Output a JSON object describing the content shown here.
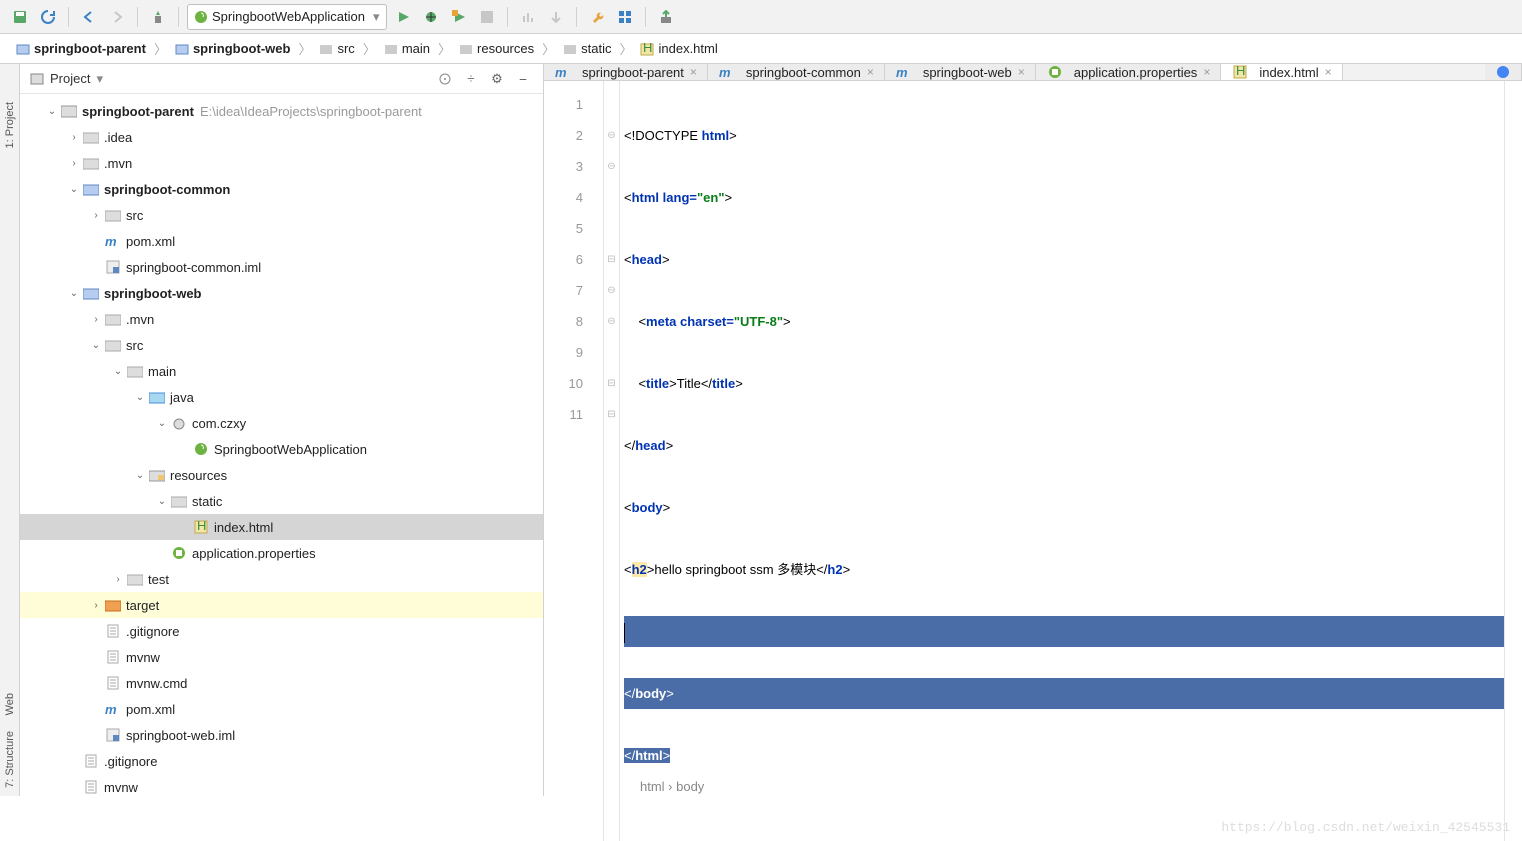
{
  "toolbar": {
    "run_config": "SpringbootWebApplication"
  },
  "breadcrumb": [
    "springboot-parent",
    "springboot-web",
    "src",
    "main",
    "resources",
    "static",
    "index.html"
  ],
  "project_panel": {
    "title": "Project"
  },
  "left_tabs": [
    "1: Project",
    "Web",
    "7: Structure"
  ],
  "tree": [
    {
      "d": 0,
      "exp": "v",
      "icon": "folder-root",
      "label": "springboot-parent",
      "bold": true,
      "hint": "E:\\idea\\IdeaProjects\\springboot-parent"
    },
    {
      "d": 1,
      "exp": ">",
      "icon": "folder",
      "label": ".idea"
    },
    {
      "d": 1,
      "exp": ">",
      "icon": "folder",
      "label": ".mvn"
    },
    {
      "d": 1,
      "exp": "v",
      "icon": "module",
      "label": "springboot-common",
      "bold": true
    },
    {
      "d": 2,
      "exp": ">",
      "icon": "folder",
      "label": "src"
    },
    {
      "d": 2,
      "exp": "",
      "icon": "maven",
      "label": "pom.xml"
    },
    {
      "d": 2,
      "exp": "",
      "icon": "iml",
      "label": "springboot-common.iml"
    },
    {
      "d": 1,
      "exp": "v",
      "icon": "module",
      "label": "springboot-web",
      "bold": true
    },
    {
      "d": 2,
      "exp": ">",
      "icon": "folder",
      "label": ".mvn"
    },
    {
      "d": 2,
      "exp": "v",
      "icon": "folder",
      "label": "src"
    },
    {
      "d": 3,
      "exp": "v",
      "icon": "folder",
      "label": "main"
    },
    {
      "d": 4,
      "exp": "v",
      "icon": "folder-src",
      "label": "java"
    },
    {
      "d": 5,
      "exp": "v",
      "icon": "package",
      "label": "com.czxy"
    },
    {
      "d": 6,
      "exp": "",
      "icon": "spring",
      "label": "SpringbootWebApplication"
    },
    {
      "d": 4,
      "exp": "v",
      "icon": "folder-res",
      "label": "resources"
    },
    {
      "d": 5,
      "exp": "v",
      "icon": "folder",
      "label": "static"
    },
    {
      "d": 6,
      "exp": "",
      "icon": "html",
      "label": "index.html",
      "selected": true
    },
    {
      "d": 5,
      "exp": "",
      "icon": "props",
      "label": "application.properties"
    },
    {
      "d": 3,
      "exp": ">",
      "icon": "folder",
      "label": "test"
    },
    {
      "d": 2,
      "exp": ">",
      "icon": "folder-target",
      "label": "target",
      "hover": true
    },
    {
      "d": 2,
      "exp": "",
      "icon": "file",
      "label": ".gitignore"
    },
    {
      "d": 2,
      "exp": "",
      "icon": "file",
      "label": "mvnw"
    },
    {
      "d": 2,
      "exp": "",
      "icon": "file",
      "label": "mvnw.cmd"
    },
    {
      "d": 2,
      "exp": "",
      "icon": "maven",
      "label": "pom.xml"
    },
    {
      "d": 2,
      "exp": "",
      "icon": "iml",
      "label": "springboot-web.iml"
    },
    {
      "d": 1,
      "exp": "",
      "icon": "file",
      "label": ".gitignore"
    },
    {
      "d": 1,
      "exp": "",
      "icon": "file",
      "label": "mvnw"
    }
  ],
  "editor_tabs": [
    {
      "icon": "maven",
      "label": "springboot-parent"
    },
    {
      "icon": "maven",
      "label": "springboot-common"
    },
    {
      "icon": "maven",
      "label": "springboot-web"
    },
    {
      "icon": "props",
      "label": "application.properties"
    },
    {
      "icon": "html",
      "label": "index.html",
      "active": true
    }
  ],
  "gutter_lines": [
    "1",
    "2",
    "3",
    "4",
    "5",
    "6",
    "7",
    "8",
    "9",
    "10",
    "11"
  ],
  "code": {
    "l1_doctype": "<!DOCTYPE ",
    "l1_html": "html",
    "l1_end": ">",
    "l2_open": "<",
    "l2_tag": "html ",
    "l2_attr": "lang=",
    "l2_str": "\"en\"",
    "l2_close": ">",
    "l3": "<head>",
    "l4_open": "    <",
    "l4_tag": "meta ",
    "l4_attr": "charset=",
    "l4_str": "\"UTF-8\"",
    "l4_close": ">",
    "l5_open": "    <",
    "l5_tag": "title",
    "l5_close": ">",
    "l5_text": "Title",
    "l5_open2": "</",
    "l5_tag2": "title",
    "l5_close2": ">",
    "l6": "</head>",
    "l7": "<body>",
    "l8_open": "<",
    "l8_tag": "h2",
    "l8_close": ">",
    "l8_text": "hello springboot ssm 多模块",
    "l8_open2": "</",
    "l8_tag2": "h2",
    "l8_close2": ">",
    "l10": "</body>",
    "l11": "</html>"
  },
  "status": "html  ›  body",
  "watermark": "https://blog.csdn.net/weixin_42545531"
}
